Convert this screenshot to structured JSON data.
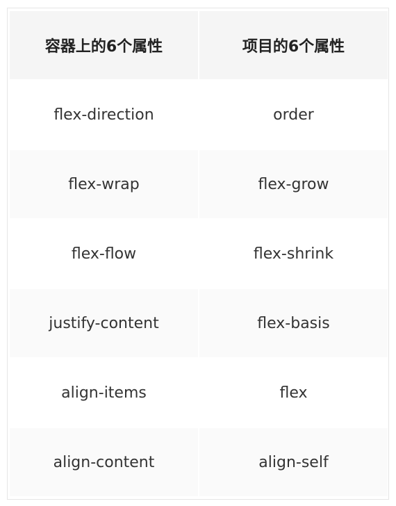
{
  "table": {
    "headers": [
      "容器上的6个属性",
      "项目的6个属性"
    ],
    "rows": [
      [
        "flex-direction",
        "order"
      ],
      [
        "flex-wrap",
        "flex-grow"
      ],
      [
        "flex-flow",
        "flex-shrink"
      ],
      [
        "justify-content",
        "flex-basis"
      ],
      [
        "align-items",
        "flex"
      ],
      [
        "align-content",
        "align-self"
      ]
    ]
  }
}
